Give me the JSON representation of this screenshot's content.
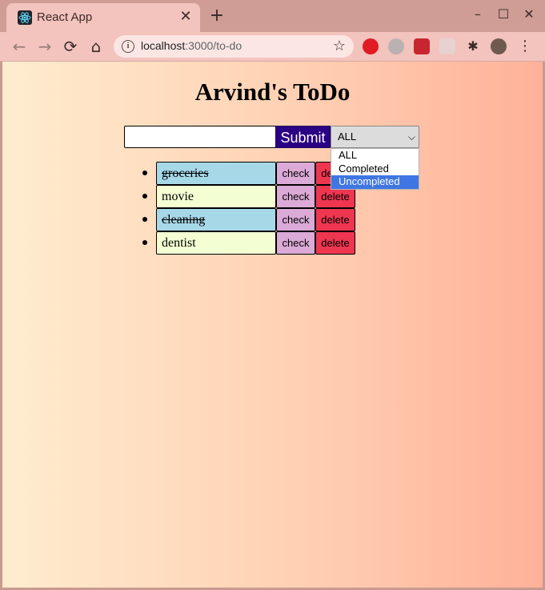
{
  "browser": {
    "tab_title": "React App",
    "tab_close": "✕",
    "new_tab": "+",
    "url_host": "localhost",
    "url_rest": ":3000/to-do",
    "win_minimize": "–",
    "win_maximize": "☐",
    "win_close": "✕",
    "icons": [
      "react-favicon",
      "back-arrow-icon",
      "forward-arrow-icon",
      "reload-icon",
      "home-icon",
      "info-icon",
      "star-icon",
      "extensions-icon",
      "profile-avatar",
      "menu-dots-icon"
    ]
  },
  "page": {
    "title": "Arvind's ToDo",
    "input_value": "",
    "submit_label": "Submit",
    "filter": {
      "selected": "ALL",
      "options": [
        "ALL",
        "Completed",
        "Uncompleted"
      ],
      "highlighted": "Uncompleted"
    },
    "todos": [
      {
        "text": "groceries",
        "completed": true,
        "check_label": "check",
        "delete_label": "delete"
      },
      {
        "text": "movie",
        "completed": false,
        "check_label": "check",
        "delete_label": "delete"
      },
      {
        "text": "cleaning",
        "completed": true,
        "check_label": "check",
        "delete_label": "delete"
      },
      {
        "text": "dentist",
        "completed": false,
        "check_label": "check",
        "delete_label": "delete"
      }
    ]
  },
  "colors": {
    "submit_bg": "#2b0084",
    "completed_bg": "#a7d8e8",
    "pending_bg": "#f3ffd3",
    "check_bg": "#dbaad6",
    "delete_bg": "#ee3651",
    "dropdown_highlight": "#3f76e4"
  }
}
